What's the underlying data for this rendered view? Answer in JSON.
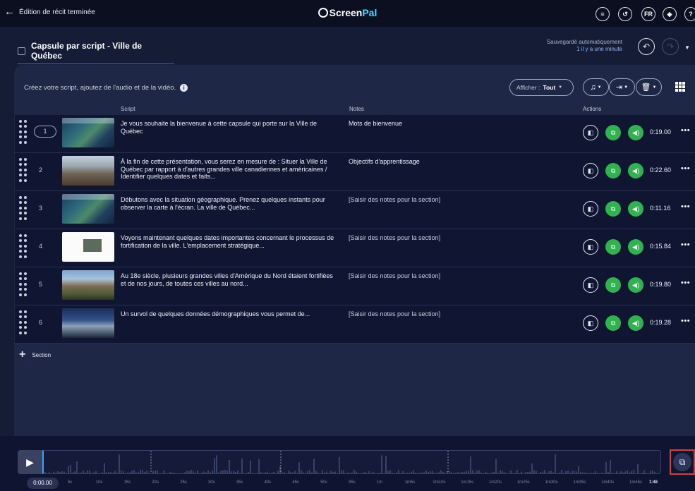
{
  "topbar": {
    "back_label": "Édition de récit terminée",
    "logo_a": "Screen",
    "logo_b": "Pal",
    "icons": [
      {
        "name": "script-list-icon",
        "glyph": "≡"
      },
      {
        "name": "history-icon",
        "glyph": "↺"
      },
      {
        "name": "language-badge",
        "glyph": "FR"
      },
      {
        "name": "layers-icon",
        "glyph": "◈"
      },
      {
        "name": "help-icon",
        "glyph": "?"
      }
    ]
  },
  "header": {
    "title": "Capsule par script - Ville de Québec",
    "autosave_label": "Sauvegardé automatiquement",
    "autosave_time": "1 il y a une minute"
  },
  "toolbar": {
    "intro": "Créez votre script, ajoutez de l'audio et de la vidéo.",
    "filter_prefix": "Afficher :",
    "filter_value": "Tout"
  },
  "columns": {
    "script": "Script",
    "notes": "Notes",
    "actions": "Actions"
  },
  "rows": [
    {
      "num": "1",
      "script": "Je vous souhaite la bienvenue à cette capsule qui porte sur la Ville de Québec",
      "notes": "Mots de bienvenue",
      "duration": "0:19.00",
      "thumb": "map"
    },
    {
      "num": "2",
      "script": "À la fin de cette présentation, vous serez en mesure de : Situer la Ville de Québec par rapport à d'autres grandes ville canadiennes et américaines / Identifier quelques dates et faits...",
      "notes": "Objectifs d'apprentissage",
      "duration": "0:22.60",
      "thumb": "city"
    },
    {
      "num": "3",
      "script": "Débutons avec la situation géographique. Prenez quelques instants pour observer la carte à l'écran. La ville de Québec...",
      "notes": "[Saisir des notes pour la section]",
      "duration": "0:11.16",
      "thumb": "map"
    },
    {
      "num": "4",
      "script": "Voyons maintenant quelques dates importantes concernant le processus de fortification de la ville. L'emplacement stratégique...",
      "notes": "[Saisir des notes pour la section]",
      "duration": "0:15.84",
      "thumb": "doc"
    },
    {
      "num": "5",
      "script": "Au 18e siècle, plusieurs grandes villes d'Amérique du Nord étaient fortifiées et de nos jours, de toutes ces villes au nord...",
      "notes": "[Saisir des notes pour la section]",
      "duration": "0:19.80",
      "thumb": "castle"
    },
    {
      "num": "6",
      "script": "Un survol de quelques données démographiques vous permet de...",
      "notes": "[Saisir des notes pour la section]",
      "duration": "0:19.28",
      "thumb": "night"
    }
  ],
  "add_section_label": "Section",
  "timeline": {
    "current_time": "0:00.00",
    "ticks": [
      "5s",
      "10s",
      "15s",
      "20s",
      "25s",
      "30s",
      "35s",
      "40s",
      "45s",
      "50s",
      "55s",
      "1m",
      "1m5s",
      "1m10s",
      "1m15s",
      "1m20s",
      "1m25s",
      "1m30s",
      "1m35s",
      "1m40s",
      "1m45s",
      "1:48"
    ]
  },
  "colors": {
    "accent_green": "#2fb34f",
    "accent_blue": "#39a0ff",
    "highlight_red": "#e53935"
  }
}
